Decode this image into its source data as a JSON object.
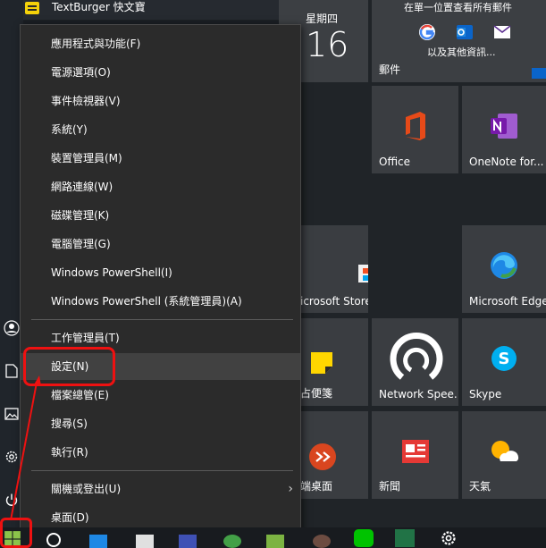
{
  "applist": {
    "top_item": "TextBurger 快文寶"
  },
  "tiles": {
    "calendar": {
      "day_name": "星期四",
      "day_number": "16"
    },
    "mail": {
      "header": "在單一位置查看所有郵件",
      "sub": "以及其他資訊...",
      "label": "郵件"
    },
    "office": {
      "label": "Office"
    },
    "onenote": {
      "label": "OneNote for..."
    },
    "store": {
      "label": "icrosoft Store"
    },
    "edge": {
      "label": "Microsoft Edge"
    },
    "sticky": {
      "label": "占便箋"
    },
    "speedtest": {
      "label": "Network Spee..."
    },
    "skype": {
      "label": "Skype"
    },
    "remote": {
      "label": "端桌面"
    },
    "news": {
      "label": "新聞"
    },
    "weather": {
      "label": "天氣"
    }
  },
  "menu": {
    "items": [
      "應用程式與功能(F)",
      "電源選項(O)",
      "事件檢視器(V)",
      "系統(Y)",
      "裝置管理員(M)",
      "網路連線(W)",
      "磁碟管理(K)",
      "電腦管理(G)",
      "Windows PowerShell(I)",
      "Windows PowerShell (系統管理員)(A)",
      "工作管理員(T)",
      "設定(N)",
      "檔案總管(E)",
      "搜尋(S)",
      "執行(R)",
      "關機或登出(U)",
      "桌面(D)"
    ]
  },
  "colors": {
    "annotation": "#e11111",
    "menu_bg": "#2b2b2b",
    "hover_bg": "#414141"
  }
}
